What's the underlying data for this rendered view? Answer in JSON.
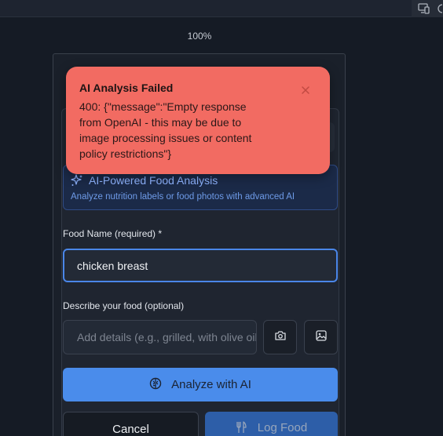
{
  "zoom": "100%",
  "toast": {
    "title": "AI Analysis Failed",
    "message": "400: {\"message\":\"Empty response from OpenAI - this may be due to image processing issues or content policy restrictions\"}"
  },
  "ai_panel": {
    "title": "AI-Powered Food Analysis",
    "subtitle": "Analyze nutrition labels or food photos with advanced AI"
  },
  "form": {
    "food_name_label": "Food Name (required) *",
    "food_name_value": "chicken breast",
    "description_label": "Describe your food (optional)",
    "description_placeholder": "Add details (e.g., grilled, with olive oil)"
  },
  "buttons": {
    "analyze": "Analyze with AI",
    "cancel": "Cancel",
    "log": "Log Food"
  },
  "colors": {
    "toast_bg": "#f26b62",
    "primary": "#4a8ceb",
    "background": "#151b25"
  },
  "icons": [
    "devices-icon",
    "close-icon",
    "sparkles-icon",
    "camera-icon",
    "image-icon",
    "brain-icon",
    "utensils-icon"
  ]
}
